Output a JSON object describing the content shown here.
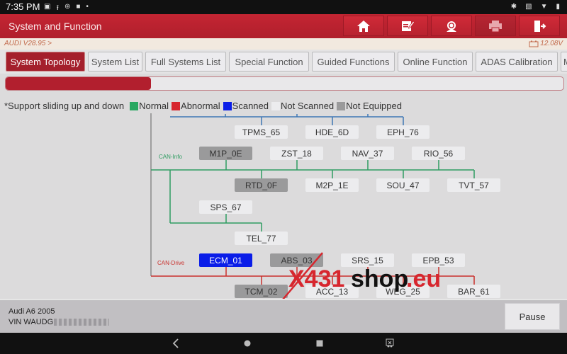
{
  "status_bar": {
    "time": "7:35 PM",
    "left_icons": [
      "image-icon",
      "upload-icon",
      "sync-icon",
      "video-icon",
      "dot-icon"
    ],
    "right_icons": [
      "bluetooth-icon",
      "cast-icon",
      "wifi-icon",
      "battery-icon"
    ]
  },
  "header": {
    "title": "System and Function",
    "buttons": [
      {
        "name": "home-button",
        "icon": "home-icon"
      },
      {
        "name": "report-button",
        "icon": "edit-report-icon"
      },
      {
        "name": "support-button",
        "icon": "headset-icon"
      },
      {
        "name": "print-button",
        "icon": "printer-icon"
      },
      {
        "name": "exit-button",
        "icon": "exit-icon"
      }
    ]
  },
  "info": {
    "version": "AUDI V28.95 >",
    "voltage": "12.08V"
  },
  "tabs": [
    {
      "label": "System Topology",
      "active": true
    },
    {
      "label": "System List",
      "active": false
    },
    {
      "label": "Full Systems List",
      "active": false
    },
    {
      "label": "Special Function",
      "active": false
    },
    {
      "label": "Guided Functions",
      "active": false
    },
    {
      "label": "Online Function",
      "active": false
    },
    {
      "label": "ADAS Calibration",
      "active": false
    },
    {
      "label": "M",
      "active": false
    }
  ],
  "progress": {
    "percent": 26
  },
  "legend": {
    "hint": "*Support sliding up and down",
    "items": [
      {
        "label": "Normal",
        "color": "#2aa862"
      },
      {
        "label": "Abnormal",
        "color": "#d7262e"
      },
      {
        "label": "Scanned",
        "color": "#0a1de8"
      },
      {
        "label": "Not Scanned",
        "color": "#ececee"
      },
      {
        "label": "Not Equipped",
        "color": "#9a9a9b"
      }
    ]
  },
  "topology": {
    "buses": [
      {
        "name": "CAN-Info",
        "color": "#2f9d62"
      },
      {
        "name": "CAN-Drive",
        "color": "#c9302c"
      }
    ],
    "bus_colors": {
      "comfort": "#3f77b5",
      "info": "#2f9d62",
      "drive": "#c9302c",
      "gateway": "#8a8a8a"
    },
    "nodes": [
      {
        "id": "TPMS_65",
        "status": "not-scanned",
        "bus": "comfort"
      },
      {
        "id": "HDE_6D",
        "status": "not-scanned",
        "bus": "comfort"
      },
      {
        "id": "EPH_76",
        "status": "not-scanned",
        "bus": "comfort"
      },
      {
        "id": "M1P_0E",
        "status": "not-equipped",
        "bus": "info"
      },
      {
        "id": "ZST_18",
        "status": "not-scanned",
        "bus": "info"
      },
      {
        "id": "NAV_37",
        "status": "not-scanned",
        "bus": "info"
      },
      {
        "id": "RIO_56",
        "status": "not-scanned",
        "bus": "info"
      },
      {
        "id": "RTD_0F",
        "status": "not-equipped",
        "bus": "info"
      },
      {
        "id": "M2P_1E",
        "status": "not-scanned",
        "bus": "info"
      },
      {
        "id": "SOU_47",
        "status": "not-scanned",
        "bus": "info"
      },
      {
        "id": "TVT_57",
        "status": "not-scanned",
        "bus": "info"
      },
      {
        "id": "SPS_67",
        "status": "not-scanned",
        "bus": "info"
      },
      {
        "id": "TEL_77",
        "status": "not-scanned",
        "bus": "info"
      },
      {
        "id": "ECM_01",
        "status": "scanned",
        "bus": "drive"
      },
      {
        "id": "ABS_03",
        "status": "not-equipped",
        "bus": "drive"
      },
      {
        "id": "SRS_15",
        "status": "not-scanned",
        "bus": "drive"
      },
      {
        "id": "EPB_53",
        "status": "not-scanned",
        "bus": "drive"
      },
      {
        "id": "TCM_02",
        "status": "not-equipped",
        "bus": "drive"
      },
      {
        "id": "ACC_13",
        "status": "not-scanned",
        "bus": "drive"
      },
      {
        "id": "WEG_25",
        "status": "not-scanned",
        "bus": "drive"
      },
      {
        "id": "BAR_61",
        "status": "not-scanned",
        "bus": "drive"
      }
    ]
  },
  "watermark": {
    "part1": "X431",
    "part2": "shop",
    "part3": ".eu"
  },
  "footer": {
    "vehicle": "Audi A6  2005",
    "vin_prefix": "VIN WAUDG",
    "pause_label": "Pause"
  },
  "navbar": {
    "buttons": [
      "back-icon",
      "home-circle-icon",
      "recents-icon",
      "screenshot-icon"
    ]
  }
}
